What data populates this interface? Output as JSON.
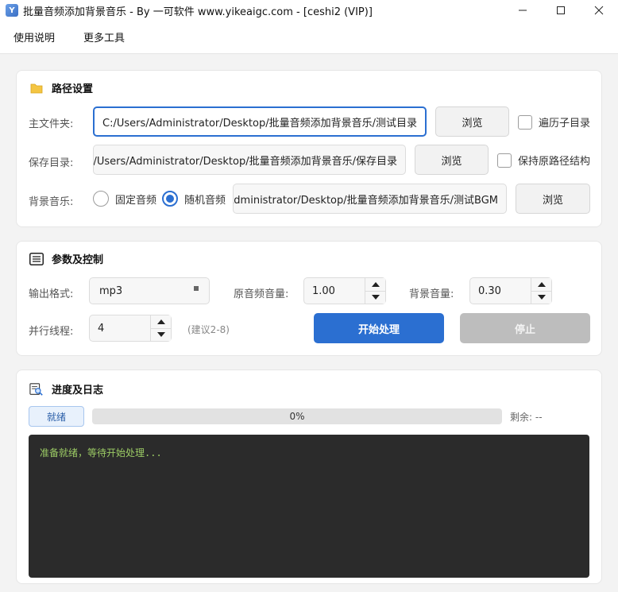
{
  "window": {
    "title": "批量音频添加背景音乐 - By 一可软件 www.yikeaigc.com - [ceshi2 (VIP)]",
    "app_icon_letter": "Y",
    "controls": [
      "minimize-icon",
      "maximize-icon",
      "close-icon"
    ]
  },
  "menu": {
    "items": [
      {
        "label": "使用说明"
      },
      {
        "label": "更多工具"
      }
    ]
  },
  "paths": {
    "title": "路径设置",
    "icon": "folder-icon",
    "main_folder_label": "主文件夹:",
    "main_folder_value": "C:/Users/Administrator/Desktop/批量音频添加背景音乐/测试目录",
    "main_browse": "浏览",
    "traverse_label": "遍历子目录",
    "save_dir_label": "保存目录:",
    "save_dir_value": "C:/Users/Administrator/Desktop/批量音频添加背景音乐/保存目录",
    "save_browse": "浏览",
    "keep_structure_label": "保持原路径结构",
    "bgm_label": "背景音乐:",
    "bgm_fixed": "固定音频",
    "bgm_random": "随机音频",
    "bgm_value": "C:/Users/Administrator/Desktop/批量音频添加背景音乐/测试BGM",
    "bgm_browse": "浏览"
  },
  "params": {
    "title": "参数及控制",
    "icon": "list-icon",
    "format_label": "输出格式:",
    "format_value": "mp3",
    "orig_volume_label": "原音频音量:",
    "orig_volume_value": "1.00",
    "bg_volume_label": "背景音量:",
    "bg_volume_value": "0.30",
    "threads_label": "并行线程:",
    "threads_value": "4",
    "threads_hint": "(建议2-8)",
    "start_label": "开始处理",
    "stop_label": "停止"
  },
  "progress": {
    "title": "进度及日志",
    "icon": "search-log-icon",
    "status": "就绪",
    "percent_text": "0%",
    "percent": 0,
    "remaining": "剩余: --",
    "log": "准备就绪，等待开始处理..."
  },
  "colors": {
    "accent": "#2b6fd1",
    "log_bg": "#2b2b2b",
    "log_text": "#9ccc65"
  }
}
